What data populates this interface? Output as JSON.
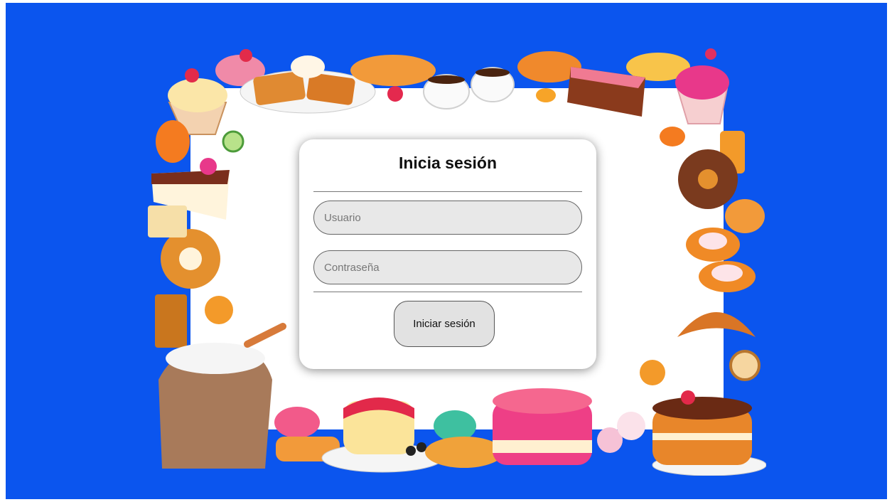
{
  "login": {
    "title": "Inicia sesión",
    "username": {
      "placeholder": "Usuario",
      "value": ""
    },
    "password": {
      "placeholder": "Contraseña",
      "value": ""
    },
    "submit_label": "Iniciar sesión"
  },
  "colors": {
    "background": "#0b55ee",
    "card": "#ffffff",
    "field": "#e8e8e8",
    "button": "#e2e2e2"
  },
  "decorations": [
    "cupcake-icon",
    "waffle-icon",
    "coffee-cups-icon",
    "cake-slice-icon",
    "pancakes-icon",
    "donut-icon",
    "bagel-icon",
    "croissant-icon",
    "flour-sack-icon",
    "macaron-icon",
    "pudding-icon",
    "layer-cake-icon",
    "meringue-icon",
    "swiss-roll-icon"
  ]
}
